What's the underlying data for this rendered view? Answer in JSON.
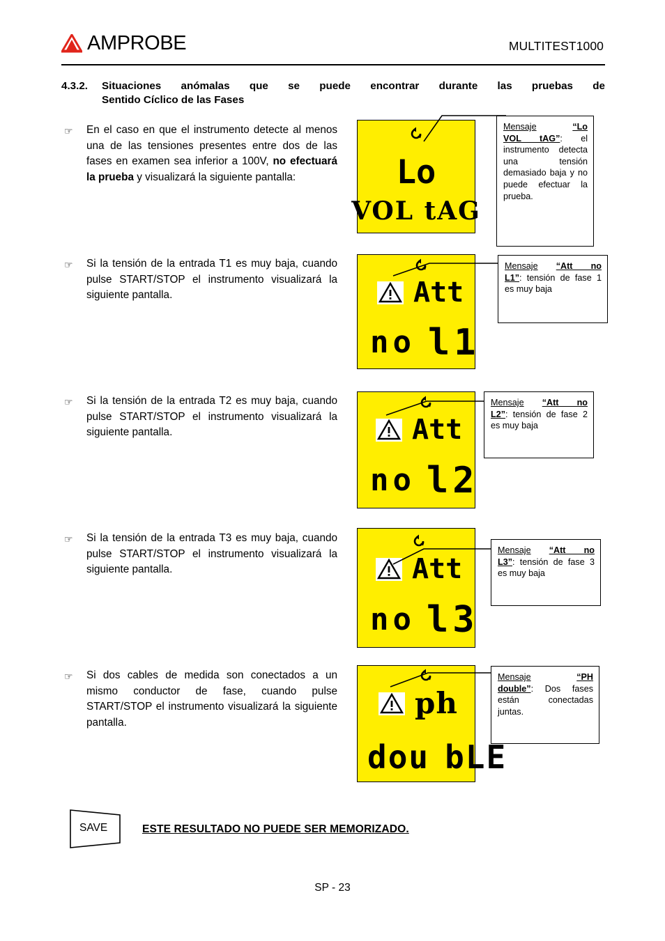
{
  "header": {
    "brand": "AMPROBE",
    "brand_icon": "amprobe-triangle-logo",
    "model": "MULTITEST1000"
  },
  "section": {
    "number": "4.3.2.",
    "title_line1": "Situaciones anómalas que se puede encontrar durante las pruebas de",
    "title_line2": "Sentido Cíclico de las Fases"
  },
  "bullets": [
    {
      "marker": "☞",
      "text_pre": "En el caso en que el instrumento detecte al menos una de las tensiones presentes entre dos de las fases en examen sea inferior a 100V, ",
      "text_bold": "no efectuará la prueba",
      "text_post": " y visualizará la siguiente pantalla:"
    },
    {
      "marker": "☞",
      "text_pre": "Si la tensión de la entrada T1 es muy baja, cuando pulse START/STOP el instrumento visualizará la siguiente pantalla.",
      "text_bold": "",
      "text_post": ""
    },
    {
      "marker": "☞",
      "text_pre": "Si la tensión de la entrada T2 es muy baja, cuando pulse START/STOP el instrumento visualizará la siguiente pantalla.",
      "text_bold": "",
      "text_post": ""
    },
    {
      "marker": "☞",
      "text_pre": "Si la tensión de la entrada T3 es muy baja, cuando pulse START/STOP el instrumento visualizará la siguiente pantalla.",
      "text_bold": "",
      "text_post": ""
    },
    {
      "marker": "☞",
      "text_pre": "Si dos cables de medida son conectados a un mismo conductor de fase, cuando pulse START/STOP el instrumento visualizará la siguiente pantalla.",
      "text_bold": "",
      "text_post": ""
    }
  ],
  "displays": [
    {
      "id": "lcd-lo-voltag",
      "rotation_icon": "phase-rotation-icon",
      "warning_icon": null,
      "line1": "Lo",
      "line2": "VOL tAG",
      "background": "#ffee00"
    },
    {
      "id": "lcd-att-no-l1",
      "rotation_icon": "phase-rotation-icon",
      "warning_icon": "warning-triangle-icon",
      "line1": "Att",
      "line2": "no l1",
      "line2_left": "no",
      "line2_right": "l1",
      "background": "#ffee00"
    },
    {
      "id": "lcd-att-no-l2",
      "rotation_icon": "phase-rotation-icon",
      "warning_icon": "warning-triangle-icon",
      "line1": "Att",
      "line2_left": "no",
      "line2_right": "l2",
      "background": "#ffee00"
    },
    {
      "id": "lcd-att-no-l3",
      "rotation_icon": "phase-rotation-icon",
      "warning_icon": "warning-triangle-icon",
      "line1": "Att",
      "line2_left": "no",
      "line2_right": "l3",
      "background": "#ffee00"
    },
    {
      "id": "lcd-ph-double",
      "rotation_icon": "phase-rotation-icon",
      "warning_icon": "warning-triangle-icon",
      "line1": "ph",
      "line2_left": "dou",
      "line2_right": "bLE",
      "background": "#ffee00"
    }
  ],
  "callouts": [
    {
      "id": "callout-lo-voltag",
      "label": "Mensaje",
      "quote": "“Lo VOL tAG”",
      "quote_key": "Lo VOL tAG",
      "body": ": el instrumento detecta una tensión demasiado baja y no puede efectuar la prueba.",
      "line1_label": "Mensaje",
      "line1_quote": "“Lo",
      "line2_quote": "VOL tAG”",
      "line2_colon": ":",
      "rest": "el instrumento detecta una tensión demasiado baja y no puede efectuar la prueba."
    },
    {
      "id": "callout-att-no-l1",
      "line1_label": "Mensaje",
      "line1_quote": "“Att no",
      "line2_quote": "L1”",
      "line2_colon": ":",
      "rest": "tensión de fase 1 es muy baja"
    },
    {
      "id": "callout-att-no-l2",
      "line1_label": "Mensaje",
      "line1_quote": "“Att no",
      "line2_quote": "L2”",
      "line2_colon": ":",
      "rest": "tensión de fase 2 es muy baja"
    },
    {
      "id": "callout-att-no-l3",
      "line1_label": "Mensaje",
      "line1_quote": "“Att no",
      "line2_quote": "L3”",
      "line2_colon": ":",
      "rest": "tensión de fase 3 es muy baja"
    },
    {
      "id": "callout-ph-double",
      "line1_label": "Mensaje",
      "line1_quote": "“PH",
      "line2_quote": "double”",
      "line2_colon": ":",
      "rest": "Dos fases están conectadas juntas."
    }
  ],
  "save_note": {
    "badge_label": "SAVE",
    "text": "ESTE RESULTADO NO PUEDE SER MEMORIZADO."
  },
  "footer": {
    "page": "SP - 23"
  },
  "colors": {
    "lcd_background": "#ffee00",
    "logo_red": "#e1251b",
    "text": "#000000"
  }
}
